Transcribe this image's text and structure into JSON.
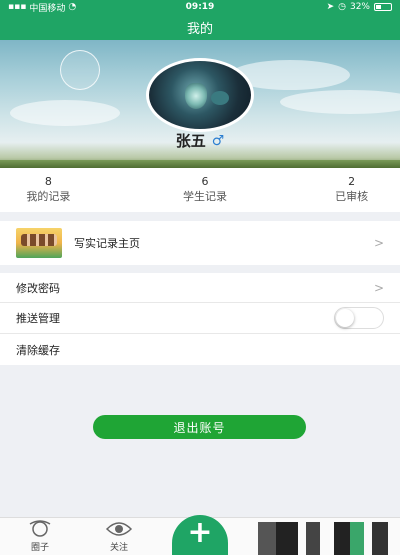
{
  "status_bar": {
    "carrier": "中国移动",
    "time": "09:19",
    "battery": "32%"
  },
  "nav": {
    "title": "我的"
  },
  "profile": {
    "name": "张五",
    "gender_symbol": "♂"
  },
  "stats": [
    {
      "value": "8",
      "label": "我的记录"
    },
    {
      "value": "6",
      "label": "学生记录"
    },
    {
      "value": "2",
      "label": "已审核"
    }
  ],
  "menu": {
    "record_home": "写实记录主页",
    "change_password": "修改密码",
    "push_management": "推送管理",
    "clear_cache": "清除缓存",
    "chevron": ">"
  },
  "push_toggle_on": false,
  "logout_label": "退出账号",
  "tabs": {
    "circle": "圈子",
    "follow": "关注",
    "add": "+"
  },
  "colors": {
    "brand_green": "#1fa565",
    "logout_green": "#1fa535"
  }
}
